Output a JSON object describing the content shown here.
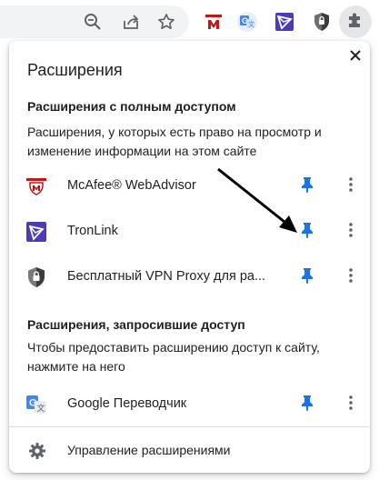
{
  "toolbar": {
    "icons": [
      "zoom-icon",
      "share-icon",
      "bookmark-star-icon",
      "mcafee-icon",
      "google-translate-icon",
      "tronlink-icon",
      "vpn-shield-icon",
      "extensions-puzzle-icon"
    ]
  },
  "panel": {
    "title": "Расширения",
    "full_access": {
      "heading": "Расширения с полным доступом",
      "description": "Расширения, у которых есть право на просмотр и изменение информации на этом сайте",
      "items": [
        {
          "name": "McAfee® WebAdvisor",
          "icon": "mcafee-icon",
          "pinned": true
        },
        {
          "name": "TronLink",
          "icon": "tronlink-icon",
          "pinned": true
        },
        {
          "name": "Бесплатный VPN Proxy для ра...",
          "icon": "vpn-shield-icon",
          "pinned": true
        }
      ]
    },
    "requested_access": {
      "heading": "Расширения, запросившие доступ",
      "description": "Чтобы предоставить расширению доступ к сайту, нажмите на него",
      "items": [
        {
          "name": "Google Переводчик",
          "icon": "google-translate-icon",
          "pinned": true
        }
      ]
    },
    "manage_label": "Управление расширениями"
  },
  "colors": {
    "pin": "#1a73e8",
    "mcafee_red": "#c01818",
    "tronlink_purple": "#4b3bb4",
    "translate_blue": "#4285f4"
  }
}
